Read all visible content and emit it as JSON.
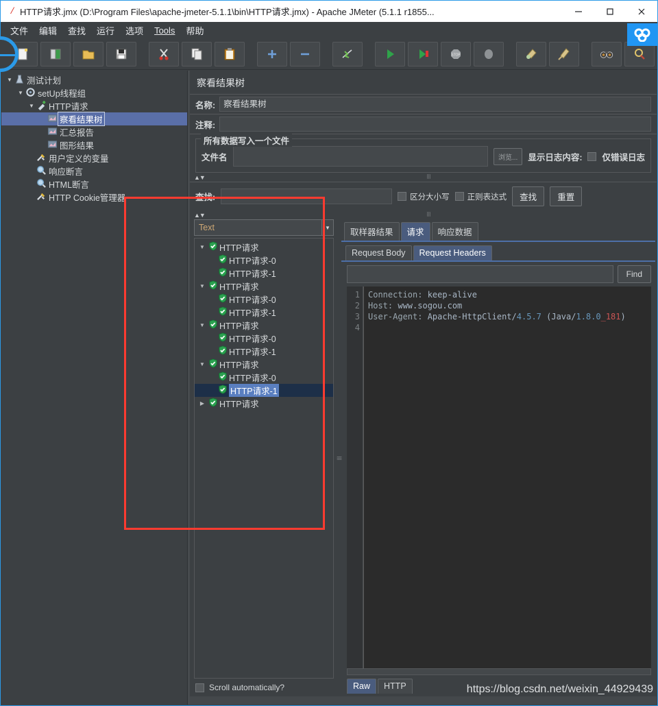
{
  "window": {
    "title": "HTTP请求.jmx (D:\\Program Files\\apache-jmeter-5.1.1\\bin\\HTTP请求.jmx) - Apache JMeter (5.1.1 r1855...",
    "app_icon": "jmeter-feather-icon",
    "minimize_label": "—",
    "maximize_label": "☐",
    "close_label": "✕"
  },
  "menu": {
    "items": [
      {
        "label": "文件",
        "name": "menu-file"
      },
      {
        "label": "编辑",
        "name": "menu-edit"
      },
      {
        "label": "查找",
        "name": "menu-search"
      },
      {
        "label": "运行",
        "name": "menu-run"
      },
      {
        "label": "选项",
        "name": "menu-options"
      },
      {
        "label": "Tools",
        "name": "menu-tools"
      },
      {
        "label": "帮助",
        "name": "menu-help"
      }
    ]
  },
  "toolbar": {
    "buttons": [
      {
        "name": "new-icon",
        "glyph": "🗒"
      },
      {
        "name": "templates-icon",
        "glyph": "📗"
      },
      {
        "name": "open-icon",
        "glyph": "📂"
      },
      {
        "name": "save-icon",
        "glyph": "💾"
      },
      {
        "name": "cut-icon",
        "glyph": "✂"
      },
      {
        "name": "copy-icon",
        "glyph": "📄"
      },
      {
        "name": "paste-icon",
        "glyph": "📋"
      },
      {
        "name": "expand-all-icon",
        "glyph": "+"
      },
      {
        "name": "collapse-all-icon",
        "glyph": "−"
      },
      {
        "name": "toggle-icon",
        "glyph": "⚡"
      },
      {
        "name": "start-icon",
        "glyph": "▶"
      },
      {
        "name": "start-no-pauses-icon",
        "glyph": "▶"
      },
      {
        "name": "stop-icon",
        "glyph": "🛑"
      },
      {
        "name": "shutdown-icon",
        "glyph": "⬣"
      },
      {
        "name": "clear-icon",
        "glyph": "🧹"
      },
      {
        "name": "clear-all-icon",
        "glyph": "🧹"
      },
      {
        "name": "search-icon",
        "glyph": "🔭"
      },
      {
        "name": "reset-search-icon",
        "glyph": "🔎"
      }
    ]
  },
  "tree": {
    "nodes": [
      {
        "label": "测试计划",
        "indent": 0,
        "arrow": "▼",
        "icon": "test-plan-icon",
        "selected": false
      },
      {
        "label": "setUp线程组",
        "indent": 1,
        "arrow": "▼",
        "icon": "setup-thread-group-icon",
        "selected": false
      },
      {
        "label": "HTTP请求",
        "indent": 2,
        "arrow": "▼",
        "icon": "http-sampler-icon",
        "selected": false
      },
      {
        "label": "察看结果树",
        "indent": 3,
        "arrow": "",
        "icon": "view-results-tree-icon",
        "selected": true
      },
      {
        "label": "汇总报告",
        "indent": 3,
        "arrow": "",
        "icon": "summary-report-icon",
        "selected": false
      },
      {
        "label": "图形结果",
        "indent": 3,
        "arrow": "",
        "icon": "graph-results-icon",
        "selected": false
      },
      {
        "label": "用户定义的变量",
        "indent": 2,
        "arrow": "",
        "icon": "user-variables-icon",
        "selected": false
      },
      {
        "label": "响应断言",
        "indent": 2,
        "arrow": "",
        "icon": "assertion-icon",
        "selected": false
      },
      {
        "label": "HTML断言",
        "indent": 2,
        "arrow": "",
        "icon": "assertion-icon",
        "selected": false
      },
      {
        "label": "HTTP Cookie管理器",
        "indent": 2,
        "arrow": "",
        "icon": "cookie-manager-icon",
        "selected": false
      }
    ]
  },
  "panel": {
    "title": "察看结果树",
    "name_label": "名称:",
    "name_value": "察看结果树",
    "comment_label": "注释:",
    "comment_value": "",
    "file_group_title": "所有数据写入一个文件",
    "filename_label": "文件名",
    "filename_value": "",
    "browse_button": "浏览...",
    "log_display_label": "显示日志内容:",
    "errors_only_label": "仅错误日志",
    "errors_only_checked": false
  },
  "search": {
    "label": "查找:",
    "value": "",
    "case_sensitive_label": "区分大小写",
    "case_sensitive_checked": false,
    "regex_label": "正则表达式",
    "regex_checked": false,
    "find_button": "查找",
    "reset_button": "重置"
  },
  "results": {
    "renderer_selected": "Text",
    "scroll_label": "Scroll automatically?",
    "scroll_checked": false,
    "nodes": [
      {
        "label": "HTTP请求",
        "indent": 0,
        "arrow": "▼",
        "status": "ok",
        "selected": false
      },
      {
        "label": "HTTP请求-0",
        "indent": 1,
        "arrow": "",
        "status": "ok",
        "selected": false
      },
      {
        "label": "HTTP请求-1",
        "indent": 1,
        "arrow": "",
        "status": "ok",
        "selected": false
      },
      {
        "label": "HTTP请求",
        "indent": 0,
        "arrow": "▼",
        "status": "ok",
        "selected": false
      },
      {
        "label": "HTTP请求-0",
        "indent": 1,
        "arrow": "",
        "status": "ok",
        "selected": false
      },
      {
        "label": "HTTP请求-1",
        "indent": 1,
        "arrow": "",
        "status": "ok",
        "selected": false
      },
      {
        "label": "HTTP请求",
        "indent": 0,
        "arrow": "▼",
        "status": "ok",
        "selected": false
      },
      {
        "label": "HTTP请求-0",
        "indent": 1,
        "arrow": "",
        "status": "ok",
        "selected": false
      },
      {
        "label": "HTTP请求-1",
        "indent": 1,
        "arrow": "",
        "status": "ok",
        "selected": false
      },
      {
        "label": "HTTP请求",
        "indent": 0,
        "arrow": "▼",
        "status": "ok",
        "selected": false
      },
      {
        "label": "HTTP请求-0",
        "indent": 1,
        "arrow": "",
        "status": "ok",
        "selected": false
      },
      {
        "label": "HTTP请求-1",
        "indent": 1,
        "arrow": "",
        "status": "ok",
        "selected": true
      },
      {
        "label": "HTTP请求",
        "indent": 0,
        "arrow": "▶",
        "status": "ok",
        "selected": false
      }
    ]
  },
  "detail": {
    "tabs": [
      {
        "label": "取样器结果",
        "active": false,
        "name": "tab-sampler-result"
      },
      {
        "label": "请求",
        "active": true,
        "name": "tab-request"
      },
      {
        "label": "响应数据",
        "active": false,
        "name": "tab-response-data"
      }
    ],
    "subtabs": [
      {
        "label": "Request Body",
        "active": false,
        "name": "subtab-request-body"
      },
      {
        "label": "Request Headers",
        "active": true,
        "name": "subtab-request-headers"
      }
    ],
    "find_value": "",
    "find_button": "Find",
    "code_lines": [
      {
        "no": "1",
        "text": "Connection: keep-alive"
      },
      {
        "no": "2",
        "text": "Host: www.sogou.com"
      },
      {
        "no": "3",
        "text": "User-Agent: Apache-HttpClient/4.5.7 (Java/1.8.0_181)"
      },
      {
        "no": "4",
        "text": ""
      }
    ],
    "bottom_tabs": [
      {
        "label": "Raw",
        "active": true,
        "name": "bottomtab-raw"
      },
      {
        "label": "HTTP",
        "active": false,
        "name": "bottomtab-http"
      }
    ]
  },
  "annotation": {
    "watermark": "https://blog.csdn.net/weixin_44929439",
    "highlight_color": "#ff3b30"
  }
}
